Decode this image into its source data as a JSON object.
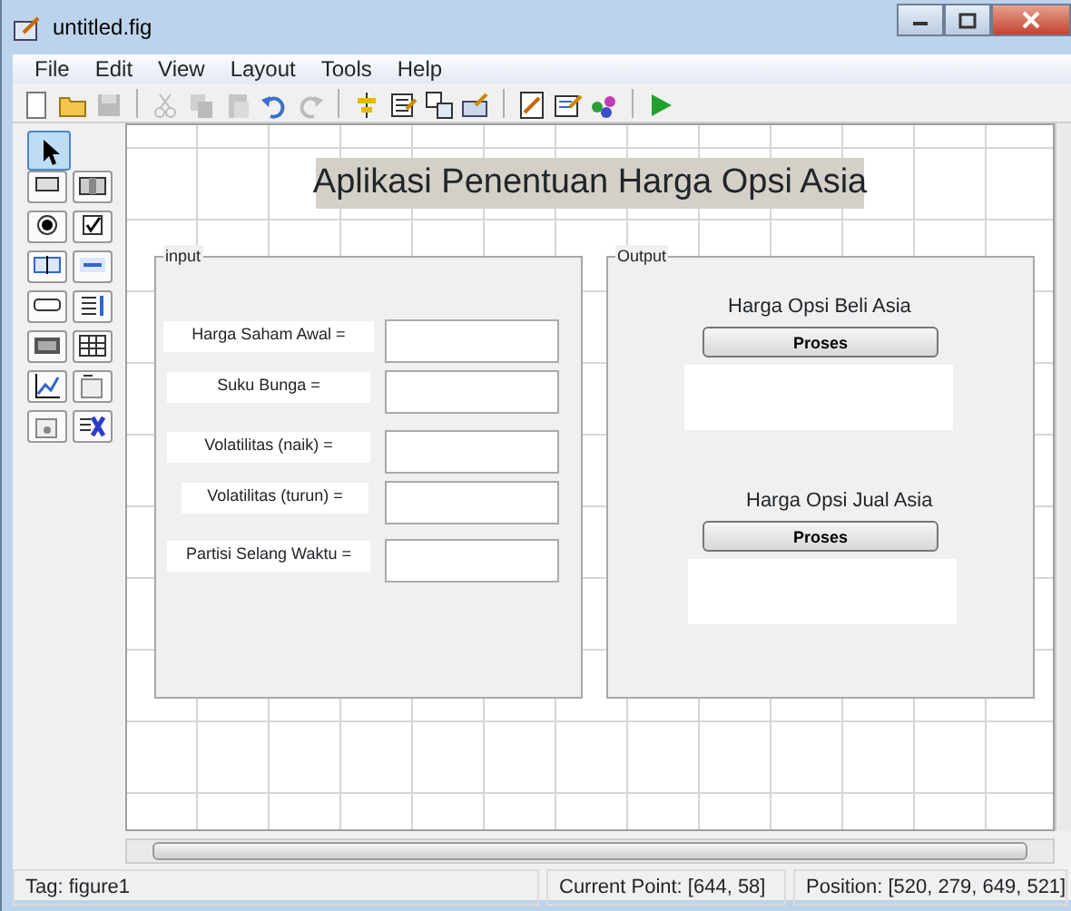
{
  "window": {
    "title": "untitled.fig"
  },
  "menu": [
    "File",
    "Edit",
    "View",
    "Layout",
    "Tools",
    "Help"
  ],
  "toolbar": [
    {
      "kind": "new",
      "disabled": false
    },
    {
      "kind": "open",
      "disabled": false
    },
    {
      "kind": "save",
      "disabled": true
    },
    {
      "kind": "sep"
    },
    {
      "kind": "cut",
      "disabled": true
    },
    {
      "kind": "copy",
      "disabled": true
    },
    {
      "kind": "paste",
      "disabled": true
    },
    {
      "kind": "undo",
      "disabled": false
    },
    {
      "kind": "redo",
      "disabled": true
    },
    {
      "kind": "sep"
    },
    {
      "kind": "align",
      "disabled": false
    },
    {
      "kind": "menu-editor",
      "disabled": false
    },
    {
      "kind": "tab-order",
      "disabled": false
    },
    {
      "kind": "toolbar-editor",
      "disabled": false
    },
    {
      "kind": "sep"
    },
    {
      "kind": "editor",
      "disabled": false
    },
    {
      "kind": "inspector",
      "disabled": false
    },
    {
      "kind": "browser",
      "disabled": false
    },
    {
      "kind": "sep"
    },
    {
      "kind": "run",
      "disabled": false
    }
  ],
  "palette": [
    {
      "kind": "select",
      "selected": true
    },
    {
      "kind": "pushbutton",
      "selected": false
    },
    {
      "kind": "slider",
      "selected": false
    },
    {
      "kind": "radio",
      "selected": false
    },
    {
      "kind": "checkbox",
      "selected": false
    },
    {
      "kind": "edit",
      "selected": false
    },
    {
      "kind": "text",
      "selected": false
    },
    {
      "kind": "popup",
      "selected": false
    },
    {
      "kind": "listbox",
      "selected": false
    },
    {
      "kind": "toggle",
      "selected": false
    },
    {
      "kind": "table",
      "selected": false
    },
    {
      "kind": "axes",
      "selected": false
    },
    {
      "kind": "panel",
      "selected": false
    },
    {
      "kind": "buttongroup",
      "selected": false
    },
    {
      "kind": "activex",
      "selected": false
    }
  ],
  "figure": {
    "title": "Aplikasi Penentuan Harga Opsi Asia",
    "input_panel": {
      "title": "input",
      "rows": [
        {
          "label": "Harga Saham Awal ="
        },
        {
          "label": "Suku Bunga ="
        },
        {
          "label": "Volatilitas (naik) ="
        },
        {
          "label": "Volatilitas (turun) ="
        },
        {
          "label": "Partisi Selang Waktu ="
        }
      ]
    },
    "output_panel": {
      "title": "Output",
      "sections": [
        {
          "heading": "Harga Opsi Beli Asia",
          "button": "Proses"
        },
        {
          "heading": "Harga Opsi Jual Asia",
          "button": "Proses"
        }
      ]
    }
  },
  "status_bar": {
    "tag": "Tag: figure1",
    "current_point": "Current Point:  [644, 58]",
    "position": "Position: [520, 279, 649, 521]"
  }
}
